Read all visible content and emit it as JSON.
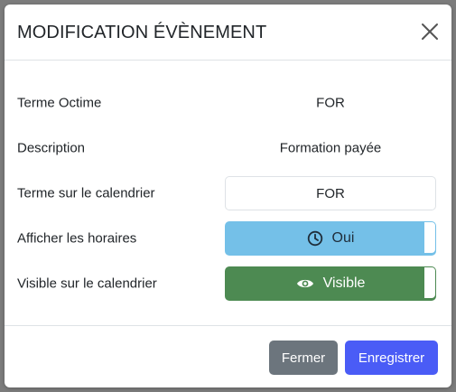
{
  "modal": {
    "title": "MODIFICATION ÉVÈNEMENT"
  },
  "fields": {
    "terme_octime": {
      "label": "Terme Octime",
      "value": "FOR"
    },
    "description": {
      "label": "Description",
      "value": "Formation payée"
    },
    "terme_calendrier": {
      "label": "Terme sur le calendrier",
      "value": "FOR"
    },
    "afficher_horaires": {
      "label": "Afficher les horaires",
      "button_label": "Oui",
      "icon": "clock-icon",
      "color": "#74c0e8"
    },
    "visible_calendrier": {
      "label": "Visible sur le calendrier",
      "button_label": "Visible",
      "icon": "eye-icon",
      "color": "#4d8a52"
    }
  },
  "footer": {
    "close_label": "Fermer",
    "save_label": "Enregistrer",
    "close_color": "#6c757d",
    "save_color": "#4a5cf6"
  }
}
